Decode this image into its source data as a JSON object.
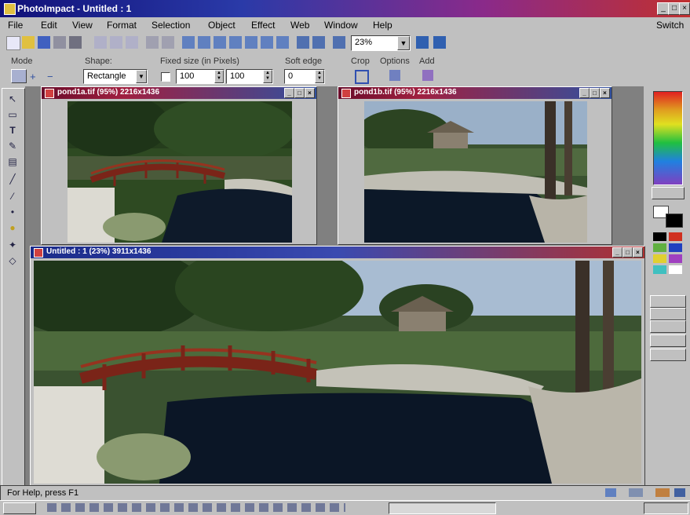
{
  "app": {
    "title": "PhotoImpact - Untitled : 1"
  },
  "menus": [
    "File",
    "Edit",
    "View",
    "Format",
    "Selection",
    "Object",
    "Effect",
    "Web",
    "Window",
    "Help"
  ],
  "menu_right": "Switch",
  "toolbar": {
    "zoom": "23%"
  },
  "attributes": {
    "mode_label": "Mode",
    "shape_label": "Shape:",
    "shape_value": "Rectangle",
    "fixed_size_label": "Fixed size (in Pixels)",
    "width_value": "100",
    "height_value": "100",
    "soft_edge_label": "Soft edge",
    "soft_edge_value": "0",
    "crop_label": "Crop",
    "options_label": "Options",
    "add_label": "Add"
  },
  "documents": [
    {
      "title": "pond1a.tif (95%) 2216x1436"
    },
    {
      "title": "pond1b.tif (95%) 2216x1436"
    },
    {
      "title": "Untitled : 1 (23%) 3911x1436"
    }
  ],
  "status": {
    "text": "For Help, press F1"
  },
  "palette_colors": [
    "#000000",
    "#d03020",
    "#60b040",
    "#2040c0",
    "#e0d030",
    "#a040c0",
    "#40c0c0",
    "#ffffff"
  ]
}
